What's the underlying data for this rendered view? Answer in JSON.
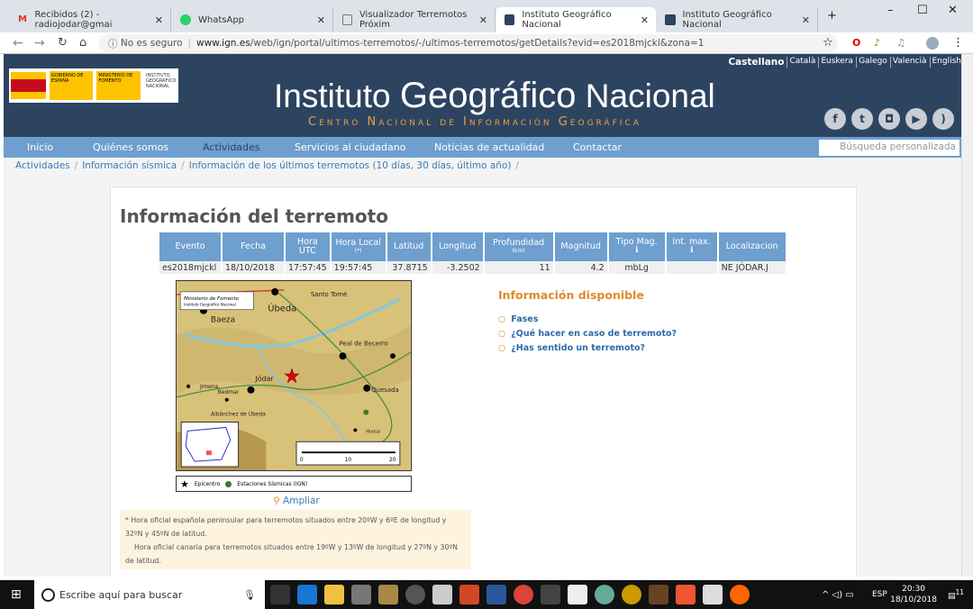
{
  "browser": {
    "tabs": [
      {
        "label": "Recibidos (2) - radiojodar@gmai",
        "icon": "gmail-icon"
      },
      {
        "label": "WhatsApp",
        "icon": "whatsapp-icon"
      },
      {
        "label": "Visualizador Terremotos Próxim",
        "icon": "document-icon"
      },
      {
        "label": "Instituto Geográfico Nacional",
        "icon": "ign-icon",
        "active": true
      },
      {
        "label": "Instituto Geográfico Nacional",
        "icon": "ign-icon"
      }
    ],
    "security": "No es seguro",
    "url_domain": "www.ign.es",
    "url_path": "/web/ign/portal/ultimos-terremotos/-/ultimos-terremotos/getDetails?evid=es2018mjckl&zona=1"
  },
  "header": {
    "title_a": "Instituto ",
    "title_b": "Geográfico",
    "title_c": " Nacional",
    "subtitle": "Centro Nacional de Información Geográfica",
    "logo_text": "GOBIERNO DE ESPAÑA · MINISTERIO DE FOMENTO · INSTITUTO GEOGRÁFICO NACIONAL",
    "languages": [
      "Castellano",
      "Català",
      "Euskera",
      "Galego",
      "Valencià",
      "English"
    ]
  },
  "nav": {
    "items": [
      "Inicio",
      "Quiénes somos",
      "Actividades",
      "Servicios al ciudadano",
      "Noticias de actualidad",
      "Contactar"
    ],
    "search_placeholder": "Búsqueda personalizada"
  },
  "breadcrumb": [
    "Actividades",
    "Información sísmica",
    "Información de los últimos terremotos (10 días, 30 días, último año)"
  ],
  "main": {
    "title": "Información del terremoto",
    "columns": [
      {
        "label": "Evento"
      },
      {
        "label": "Fecha"
      },
      {
        "label": "Hora UTC"
      },
      {
        "label": "Hora Local",
        "sub": "(*)"
      },
      {
        "label": "Latitud"
      },
      {
        "label": "Longitud"
      },
      {
        "label": "Profundidad",
        "sub": "(km)"
      },
      {
        "label": "Magnitud"
      },
      {
        "label": "Tipo Mag.",
        "sub": "ℹ"
      },
      {
        "label": "Int. max.",
        "sub": "ℹ"
      },
      {
        "label": "Localizacion"
      }
    ],
    "row": [
      "es2018mjckl",
      "18/10/2018",
      "17:57:45",
      "19:57:45",
      "37.8715",
      "-3.2502",
      "11",
      "4.2",
      "mbLg",
      "",
      "NE JÓDAR.J"
    ],
    "map": {
      "credit1": "Ministerio de Fomento",
      "credit2": "Instituto Geográfico Nacional",
      "places": [
        "Úbeda",
        "Baeza",
        "Santo Tomé",
        "Peal de Becerro",
        "Jódar",
        "Jimena",
        "Bedmar",
        "Albánchez de Úbeda",
        "Quesada",
        "Huesa"
      ],
      "scale": [
        "0",
        "10",
        "20"
      ],
      "legend_epicentro": "Epicentro",
      "legend_estaciones": "Estaciones Sísmicas (IGN)"
    },
    "ampliar": "Ampliar",
    "note1": "* Hora oficial española peninsular para terremotos situados entre 20ºW y 6ºE de longitud y 32ºN y 45ºN de latitud.",
    "note2": "Hora oficial canaria para terremotos situados entre 19ºW y 13ºW de longitud y 27ºN y 30ºN de latitud.",
    "info_title": "Información disponible",
    "info_links": [
      "Fases",
      "¿Qué hacer en caso de terremoto?",
      "¿Has sentido un terremoto?"
    ]
  },
  "taskbar": {
    "search": "Escribe aquí para buscar",
    "lang": "ESP",
    "time": "20:30",
    "date": "18/10/2018",
    "notifications": "11"
  },
  "colors": {
    "header": "#2d4461",
    "nav": "#6e9fce",
    "accent": "#e08a2c"
  }
}
